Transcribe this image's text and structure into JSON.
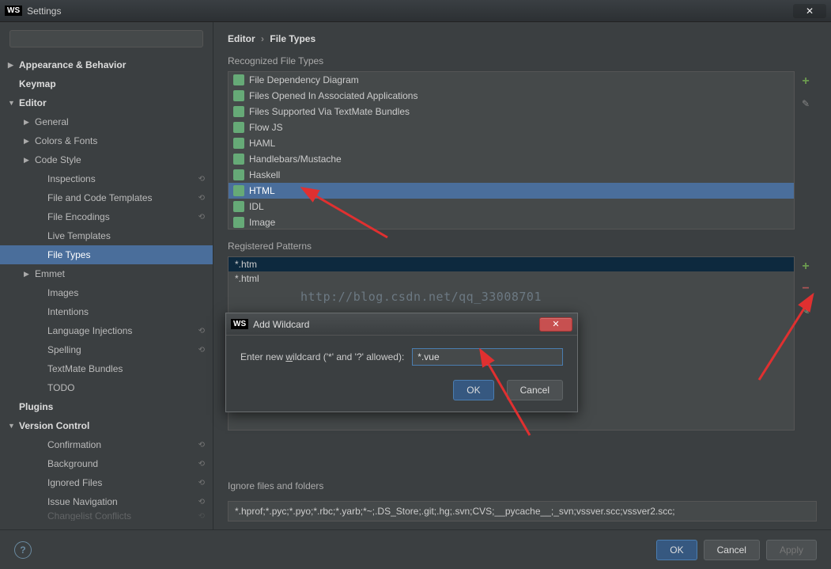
{
  "window": {
    "title": "Settings"
  },
  "sidebar": {
    "items": [
      {
        "label": "Appearance & Behavior",
        "level": 1,
        "bold": true,
        "arrow": "▶"
      },
      {
        "label": "Keymap",
        "level": 1,
        "bold": true
      },
      {
        "label": "Editor",
        "level": 1,
        "bold": true,
        "arrow": "▼"
      },
      {
        "label": "General",
        "level": 2,
        "arrow": "▶"
      },
      {
        "label": "Colors & Fonts",
        "level": 2,
        "arrow": "▶"
      },
      {
        "label": "Code Style",
        "level": 2,
        "arrow": "▶"
      },
      {
        "label": "Inspections",
        "level": 3,
        "reset": true
      },
      {
        "label": "File and Code Templates",
        "level": 3,
        "reset": true
      },
      {
        "label": "File Encodings",
        "level": 3,
        "reset": true
      },
      {
        "label": "Live Templates",
        "level": 3
      },
      {
        "label": "File Types",
        "level": 3,
        "selected": true
      },
      {
        "label": "Emmet",
        "level": 2,
        "arrow": "▶"
      },
      {
        "label": "Images",
        "level": 3
      },
      {
        "label": "Intentions",
        "level": 3
      },
      {
        "label": "Language Injections",
        "level": 3,
        "reset": true
      },
      {
        "label": "Spelling",
        "level": 3,
        "reset": true
      },
      {
        "label": "TextMate Bundles",
        "level": 3
      },
      {
        "label": "TODO",
        "level": 3
      },
      {
        "label": "Plugins",
        "level": 1,
        "bold": true
      },
      {
        "label": "Version Control",
        "level": 1,
        "bold": true,
        "arrow": "▼"
      },
      {
        "label": "Confirmation",
        "level": 3,
        "reset": true
      },
      {
        "label": "Background",
        "level": 3,
        "reset": true
      },
      {
        "label": "Ignored Files",
        "level": 3,
        "reset": true
      },
      {
        "label": "Issue Navigation",
        "level": 3,
        "reset": true
      },
      {
        "label": "Changelist Conflicts",
        "level": 3,
        "reset": true,
        "cut": true
      }
    ]
  },
  "breadcrumb": {
    "a": "Editor",
    "b": "File Types"
  },
  "filetypes": {
    "heading": "Recognized File Types",
    "items": [
      "File Dependency Diagram",
      "Files Opened In Associated Applications",
      "Files Supported Via TextMate Bundles",
      "Flow JS",
      "HAML",
      "Handlebars/Mustache",
      "Haskell",
      "HTML",
      "IDL",
      "Image"
    ],
    "selected": 7
  },
  "patterns": {
    "heading": "Registered Patterns",
    "items": [
      "*.htm",
      "*.html"
    ],
    "selected": 0
  },
  "ignore": {
    "heading": "Ignore files and folders",
    "value": "*.hprof;*.pyc;*.pyo;*.rbc;*.yarb;*~;.DS_Store;.git;.hg;.svn;CVS;__pycache__;_svn;vssver.scc;vssver2.scc;"
  },
  "footer": {
    "ok": "OK",
    "cancel": "Cancel",
    "apply": "Apply"
  },
  "dialog": {
    "title": "Add Wildcard",
    "label_pre": "Enter new ",
    "label_u": "w",
    "label_post": "ildcard ('*' and '?' allowed):",
    "value": "*.vue",
    "ok": "OK",
    "cancel": "Cancel"
  },
  "watermark": "http://blog.csdn.net/qq_33008701"
}
